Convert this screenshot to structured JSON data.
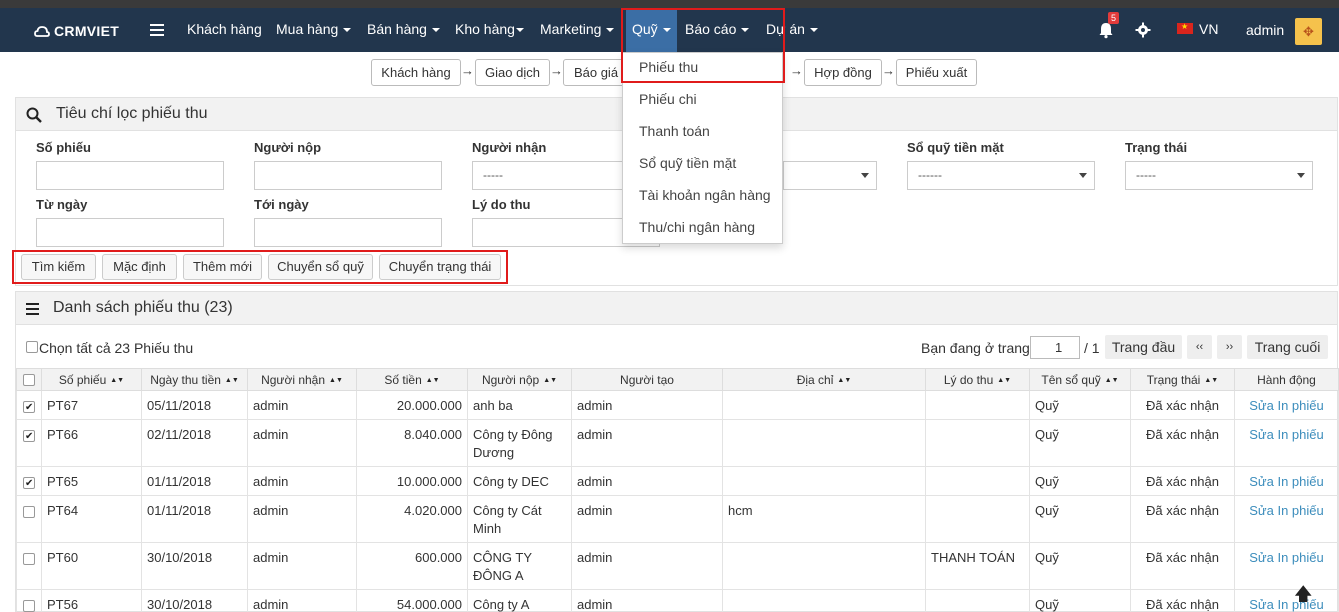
{
  "brand": {
    "name": "CRMVIET"
  },
  "nav": {
    "items": [
      {
        "label": "Khách hàng"
      },
      {
        "label": "Mua hàng"
      },
      {
        "label": "Bán hàng"
      },
      {
        "label": "Kho hàng"
      },
      {
        "label": "Marketing"
      },
      {
        "label": "Quỹ"
      },
      {
        "label": "Báo cáo"
      },
      {
        "label": "Dự án"
      }
    ],
    "notification_count": "5",
    "language": "VN",
    "user": "admin"
  },
  "flow": [
    "Khách hàng",
    "Giao dịch",
    "Báo giá",
    "Hợp đồng",
    "Phiếu xuất"
  ],
  "dropdown": {
    "items": [
      "Phiếu thu",
      "Phiếu chi",
      "Thanh toán",
      "Sổ quỹ tiền mặt",
      "Tài khoản ngân hàng",
      "Thu/chi ngân hàng"
    ]
  },
  "filter": {
    "title": "Tiêu chí lọc phiếu thu",
    "labels": {
      "so_phieu": "Số phiếu",
      "nguoi_nop": "Người nộp",
      "nguoi_nhan": "Người nhận",
      "so_quy": "Sổ quỹ tiền mặt",
      "trang_thai": "Trạng thái",
      "tu_ngay": "Từ ngày",
      "toi_ngay": "Tới ngày",
      "ly_do": "Lý do thu"
    },
    "select_placeholder_1": "-----",
    "select_placeholder_2": "------",
    "buttons": {
      "search": "Tìm kiếm",
      "default": "Mặc định",
      "add": "Thêm mới",
      "move_fund": "Chuyển sổ quỹ",
      "move_status": "Chuyển trạng thái"
    }
  },
  "list": {
    "title": "Danh sách phiếu thu (23)",
    "select_all": "Chọn tất cả 23 Phiếu thu",
    "pager": {
      "prefix": "Bạn đang ở trang",
      "current": "1",
      "total": "/ 1",
      "first": "Trang đầu",
      "prev": "‹‹",
      "next": "››",
      "last": "Trang cuối"
    },
    "columns": [
      "Số phiếu",
      "Ngày thu tiền",
      "Người nhận",
      "Số tiền",
      "Người nộp",
      "Người tạo",
      "Địa chỉ",
      "Lý do thu",
      "Tên sổ quỹ",
      "Trạng thái",
      "Hành động"
    ],
    "rows": [
      {
        "checked": true,
        "so_phieu": "PT67",
        "ngay": "05/11/2018",
        "nguoi_nhan": "admin",
        "so_tien": "20.000.000",
        "nguoi_nop": "anh ba",
        "nguoi_tao": "admin",
        "dia_chi": "",
        "ly_do": "",
        "so_quy": "Quỹ",
        "trang_thai": "Đã xác nhận",
        "action": "Sửa In phiếu"
      },
      {
        "checked": true,
        "so_phieu": "PT66",
        "ngay": "02/11/2018",
        "nguoi_nhan": "admin",
        "so_tien": "8.040.000",
        "nguoi_nop": "Công ty Đông Dương",
        "nguoi_tao": "admin",
        "dia_chi": "",
        "ly_do": "",
        "so_quy": "Quỹ",
        "trang_thai": "Đã xác nhận",
        "action": "Sửa In phiếu"
      },
      {
        "checked": true,
        "so_phieu": "PT65",
        "ngay": "01/11/2018",
        "nguoi_nhan": "admin",
        "so_tien": "10.000.000",
        "nguoi_nop": "Công ty DEC",
        "nguoi_tao": "admin",
        "dia_chi": "",
        "ly_do": "",
        "so_quy": "Quỹ",
        "trang_thai": "Đã xác nhận",
        "action": "Sửa In phiếu"
      },
      {
        "checked": false,
        "so_phieu": "PT64",
        "ngay": "01/11/2018",
        "nguoi_nhan": "admin",
        "so_tien": "4.020.000",
        "nguoi_nop": "Công ty Cát Minh",
        "nguoi_tao": "admin",
        "dia_chi": "hcm",
        "ly_do": "",
        "so_quy": "Quỹ",
        "trang_thai": "Đã xác nhận",
        "action": "Sửa In phiếu"
      },
      {
        "checked": false,
        "so_phieu": "PT60",
        "ngay": "30/10/2018",
        "nguoi_nhan": "admin",
        "so_tien": "600.000",
        "nguoi_nop": "CÔNG TY ĐÔNG A",
        "nguoi_tao": "admin",
        "dia_chi": "",
        "ly_do": "THANH TOÁN",
        "so_quy": "Quỹ",
        "trang_thai": "Đã xác nhận",
        "action": "Sửa In phiếu"
      },
      {
        "checked": false,
        "so_phieu": "PT56",
        "ngay": "30/10/2018",
        "nguoi_nhan": "admin",
        "so_tien": "54.000.000",
        "nguoi_nop": "Công ty A",
        "nguoi_tao": "admin",
        "dia_chi": "",
        "ly_do": "",
        "so_quy": "Quỹ",
        "trang_thai": "Đã xác nhận",
        "action": "Sửa In phiếu"
      }
    ]
  },
  "colors": {
    "navbar": "#22364d",
    "active_nav": "#3b6ea5",
    "highlight": "#e01b1b",
    "link": "#3c8dbc"
  }
}
